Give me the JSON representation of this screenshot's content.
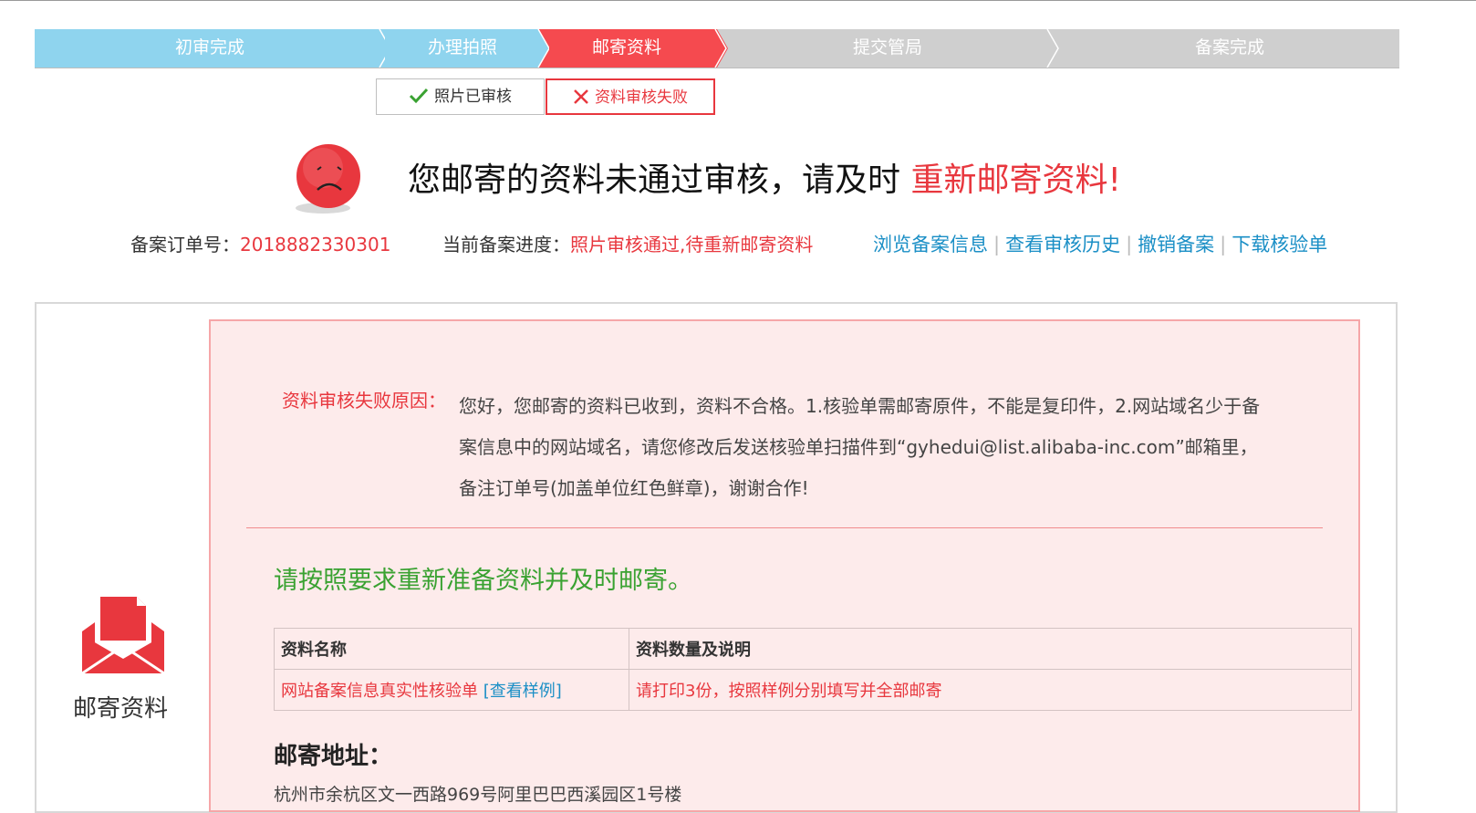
{
  "steps": [
    {
      "label": "初审完成",
      "state": "done"
    },
    {
      "label": "办理拍照",
      "state": "done"
    },
    {
      "label": "邮寄资料",
      "state": "active"
    },
    {
      "label": "提交管局",
      "state": "todo"
    },
    {
      "label": "备案完成",
      "state": "todo"
    }
  ],
  "subtabs": {
    "photo_ok": "照片已审核",
    "material_fail": "资料审核失败"
  },
  "headline": {
    "text": "您邮寄的资料未通过审核，请及时 ",
    "highlight": "重新邮寄资料!"
  },
  "order": {
    "label": "备案订单号：",
    "value": "2018882330301"
  },
  "progress": {
    "label": "当前备案进度：",
    "value": "照片审核通过,待重新邮寄资料"
  },
  "links": [
    "浏览备案信息",
    "查看审核历史",
    "撤销备案",
    "下载核验单"
  ],
  "sidebar": {
    "label": "邮寄资料"
  },
  "failure": {
    "label": "资料审核失败原因：",
    "text": "您好，您邮寄的资料已收到，资料不合格。1.核验单需邮寄原件，不能是复印件，2.网站域名少于备案信息中的网站域名，请您修改后发送核验单扫描件到“gyhedui@list.alibaba-inc.com”邮箱里，备注订单号(加盖单位红色鲜章)，谢谢合作!"
  },
  "instruction": "请按照要求重新准备资料并及时邮寄。",
  "table": {
    "headers": [
      "资料名称",
      "资料数量及说明"
    ],
    "rows": [
      {
        "name": "网站备案信息真实性核验单",
        "link": "[查看样例]",
        "desc": "请打印3份，按照样例分别填写并全部邮寄"
      }
    ]
  },
  "address": {
    "title": "邮寄地址：",
    "text": "杭州市余杭区文一西路969号阿里巴巴西溪园区1号楼"
  },
  "colors": {
    "step_done": "#8fd4ee",
    "step_active": "#f54a4f",
    "step_todo": "#cfcfcf",
    "accent_red": "#e8373e",
    "link_blue": "#1b8fc6",
    "success_green": "#3aa232",
    "panel_pink": "#fdebeb"
  }
}
